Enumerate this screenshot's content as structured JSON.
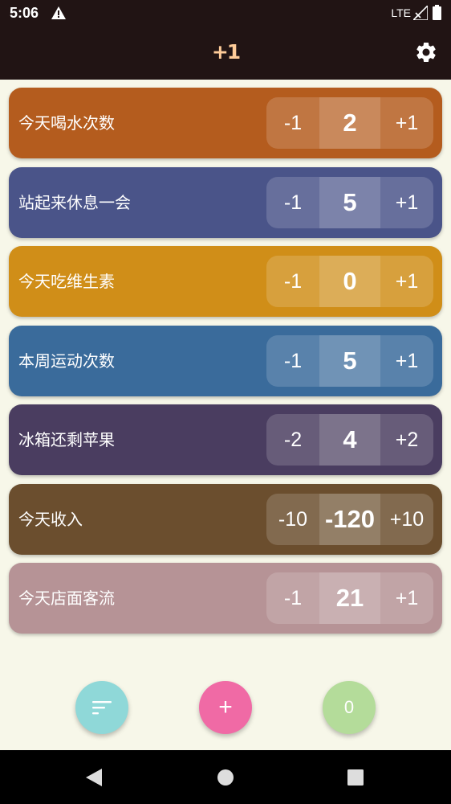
{
  "status_bar": {
    "time": "5:06",
    "network": "LTE",
    "icons": [
      "alert-icon",
      "signal-icon",
      "battery-icon"
    ]
  },
  "app_bar": {
    "title": "+1",
    "settings_icon": "gear-icon"
  },
  "counters": [
    {
      "label": "今天喝水次数",
      "dec": "-1",
      "value": "2",
      "inc": "+1",
      "color": "#b45c1e"
    },
    {
      "label": "站起来休息一会",
      "dec": "-1",
      "value": "5",
      "inc": "+1",
      "color": "#4a5489"
    },
    {
      "label": "今天吃维生素",
      "dec": "-1",
      "value": "0",
      "inc": "+1",
      "color": "#d08e18"
    },
    {
      "label": "本周运动次数",
      "dec": "-1",
      "value": "5",
      "inc": "+1",
      "color": "#3a6b9b"
    },
    {
      "label": "冰箱还剩苹果",
      "dec": "-2",
      "value": "4",
      "inc": "+2",
      "color": "#4a3d60"
    },
    {
      "label": "今天收入",
      "dec": "-10",
      "value": "-120",
      "inc": "+10",
      "color": "#6b4e2e"
    },
    {
      "label": "今天店面客流",
      "dec": "-1",
      "value": "21",
      "inc": "+1",
      "color": "#b69396"
    }
  ],
  "fabs": {
    "sort": {
      "icon": "sort-icon",
      "color": "#8fd8d8"
    },
    "add": {
      "label": "+",
      "color": "#f06aa5"
    },
    "reset": {
      "label": "0",
      "color": "#b4dc9a"
    }
  },
  "nav_bar": {
    "icons": [
      "back-icon",
      "home-icon",
      "recents-icon"
    ]
  },
  "colors": {
    "background": "#f7f7e9",
    "app_bar": "#211414",
    "title": "#ffcc99"
  }
}
